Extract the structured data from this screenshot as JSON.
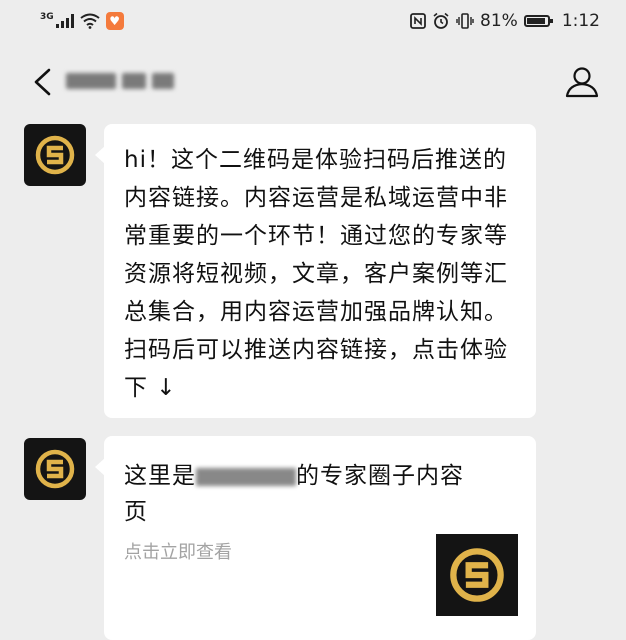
{
  "status_bar": {
    "network": "3G",
    "battery_text": "81%",
    "battery_level": 0.81,
    "time": "1:12"
  },
  "nav": {
    "back_icon": "chevron-left-icon",
    "profile_icon": "person-icon"
  },
  "messages": [
    {
      "type": "text",
      "avatar_icon": "gold-logo-icon",
      "text": "hi！这个二维码是体验扫码后推送的内容链接。内容运营是私域运营中非常重要的一个环节！通过您的专家等资源将短视频，文章，客户案例等汇总集合，用内容运营加强品牌认知。扫码后可以推送内容链接，点击体验下 ↓"
    },
    {
      "type": "card",
      "avatar_icon": "gold-logo-icon",
      "title_prefix": "这里是",
      "title_suffix": "的专家圈子内容",
      "title_line2": "页",
      "subtitle": "点击立即查看",
      "thumb_icon": "gold-logo-icon"
    }
  ],
  "colors": {
    "background": "#ededed",
    "bubble": "#ffffff",
    "logo_gold": "#e0b34a",
    "avatar_bg": "#141414"
  }
}
